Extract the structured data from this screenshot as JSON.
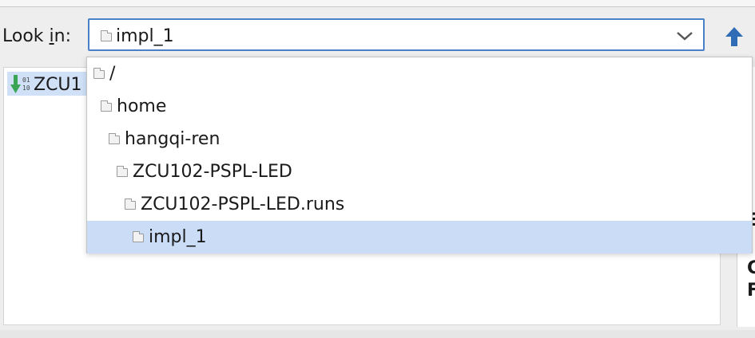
{
  "dialog": {
    "look_in_prefix": "Look ",
    "look_in_mnemonic": "i",
    "look_in_suffix": "n:",
    "current_folder": "impl_1"
  },
  "file_list": {
    "items": [
      {
        "label": "ZCU1",
        "icon": "download-bitstream-icon",
        "selected": true
      }
    ]
  },
  "dropdown": {
    "items": [
      {
        "label": "/",
        "icon": "folder-icon",
        "selected": false
      },
      {
        "label": "home",
        "icon": "folder-icon",
        "selected": false
      },
      {
        "label": "hangqi-ren",
        "icon": "folder-icon",
        "selected": false
      },
      {
        "label": "ZCU102-PSPL-LED",
        "icon": "folder-icon",
        "selected": false
      },
      {
        "label": "ZCU102-PSPL-LED.runs",
        "icon": "folder-icon",
        "selected": false
      },
      {
        "label": "impl_1",
        "icon": "folder-icon",
        "selected": true
      }
    ]
  },
  "right_panel": {
    "fragments": [
      "i",
      "E",
      "I",
      "C",
      "F"
    ]
  },
  "colors": {
    "accent": "#4a80c8",
    "selection": "#cbdcf7",
    "up_arrow": "#2f6cb5",
    "download_arrow": "#3aa655"
  }
}
